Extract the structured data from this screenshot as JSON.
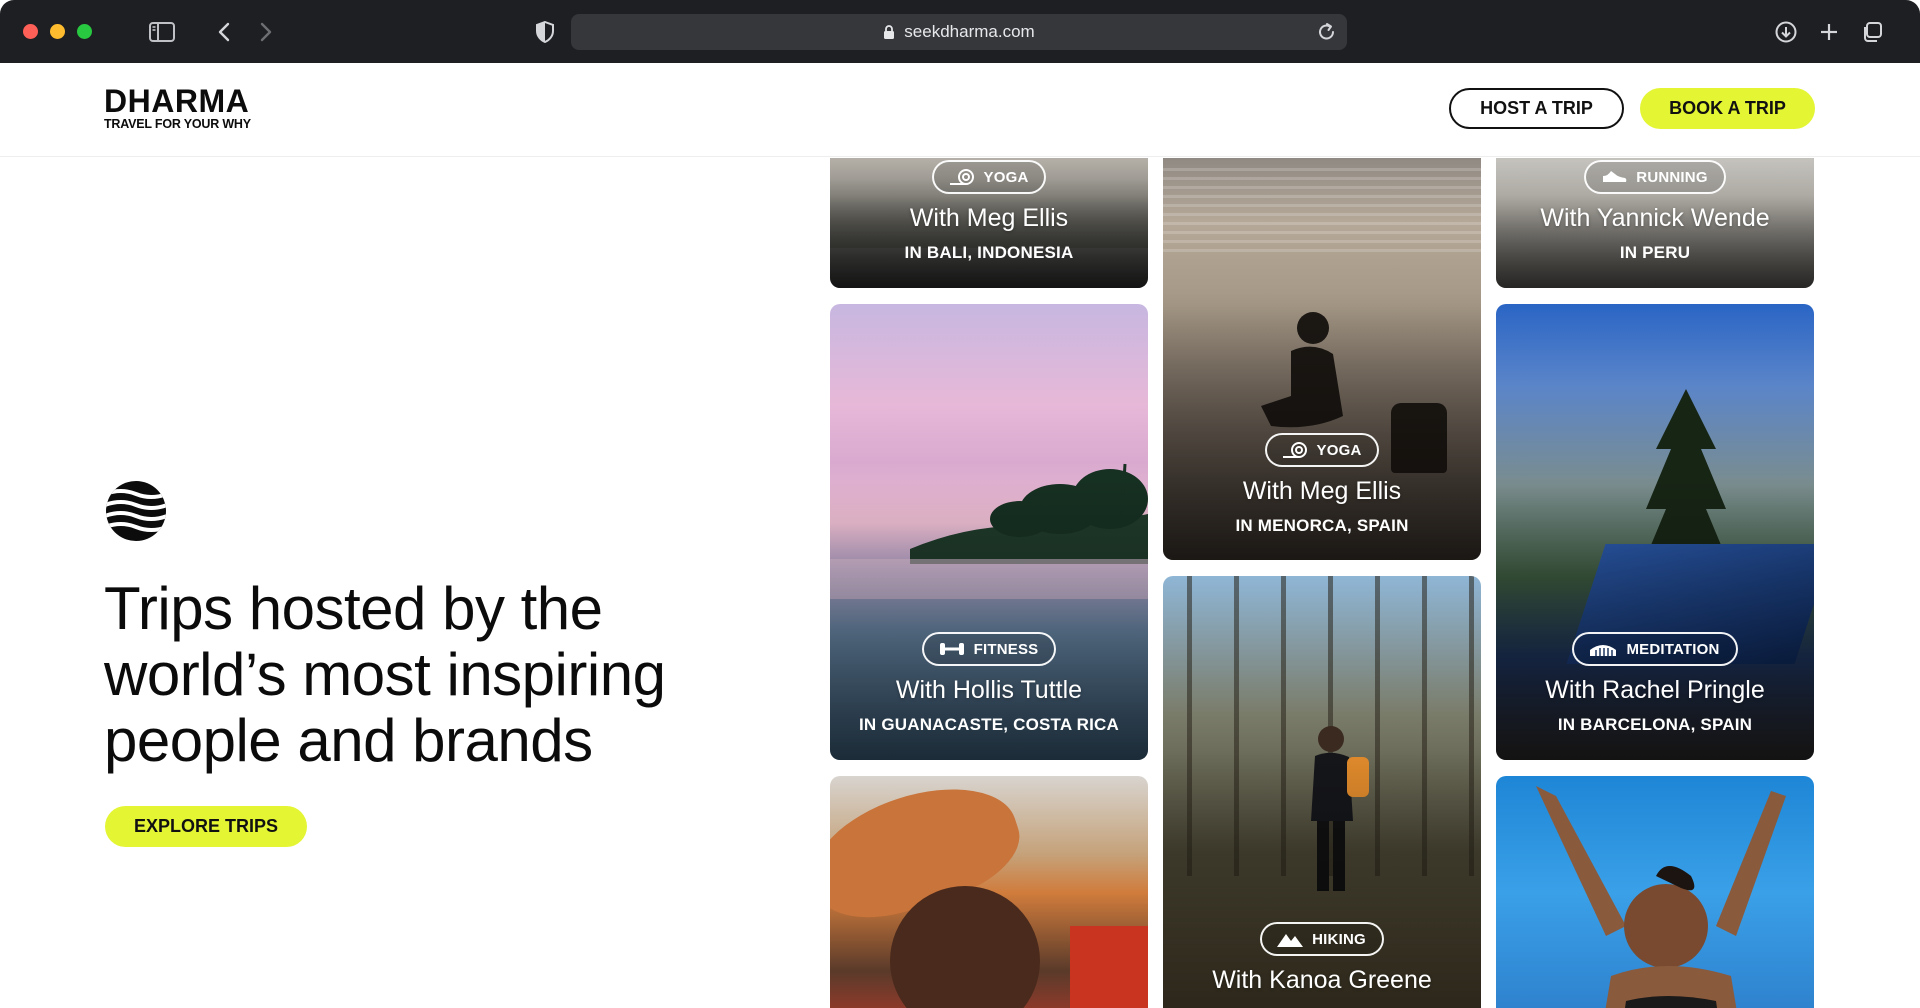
{
  "browser": {
    "url": "seekdharma.com"
  },
  "header": {
    "logo_word": "DHARMA",
    "logo_tagline": "TRAVEL FOR YOUR WHY",
    "host_button": "HOST A TRIP",
    "book_button": "BOOK A TRIP"
  },
  "hero": {
    "title": "Trips hosted by the world’s most inspiring people and brands",
    "explore_button": "EXPLORE TRIPS"
  },
  "colors": {
    "accent": "#e4f533",
    "chrome_bg": "#1e1f22",
    "text": "#0b0b0b"
  },
  "trips": {
    "bali": {
      "category": "YOGA",
      "icon": "yoga-mat-icon",
      "host": "With Meg Ellis",
      "location": "IN BALI, INDONESIA"
    },
    "menorca": {
      "category": "YOGA",
      "icon": "yoga-mat-icon",
      "host": "With Meg Ellis",
      "location": "IN MENORCA, SPAIN"
    },
    "peru": {
      "category": "RUNNING",
      "icon": "running-shoe-icon",
      "host": "With Yannick Wende",
      "location": "IN PERU"
    },
    "guanacaste": {
      "category": "FITNESS",
      "icon": "dumbbell-icon",
      "host": "With Hollis Tuttle",
      "location": "IN GUANACASTE, COSTA RICA"
    },
    "barcelona": {
      "category": "MEDITATION",
      "icon": "meditation-icon",
      "host": "With Rachel Pringle",
      "location": "IN BARCELONA, SPAIN"
    },
    "kanoa": {
      "category": "HIKING",
      "icon": "mountain-icon",
      "host": "With Kanoa Greene"
    }
  }
}
